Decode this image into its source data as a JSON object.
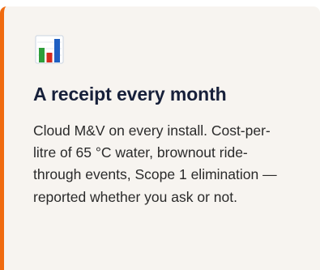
{
  "card": {
    "icon": "bar-chart-icon",
    "title": "A receipt every month",
    "body": "Cloud M&V on every install. Cost-per-litre of 65 °C water, brownout ride-through events, Scope 1 elimination — reported whether you ask or not."
  },
  "colors": {
    "accent": "#f06a0f",
    "card_background": "#f7f4f0",
    "title": "#17203a",
    "body_text": "#2a2a2a",
    "bar_green": "#2e9e3a",
    "bar_red": "#d42a1e",
    "bar_blue": "#1f5fc2"
  }
}
